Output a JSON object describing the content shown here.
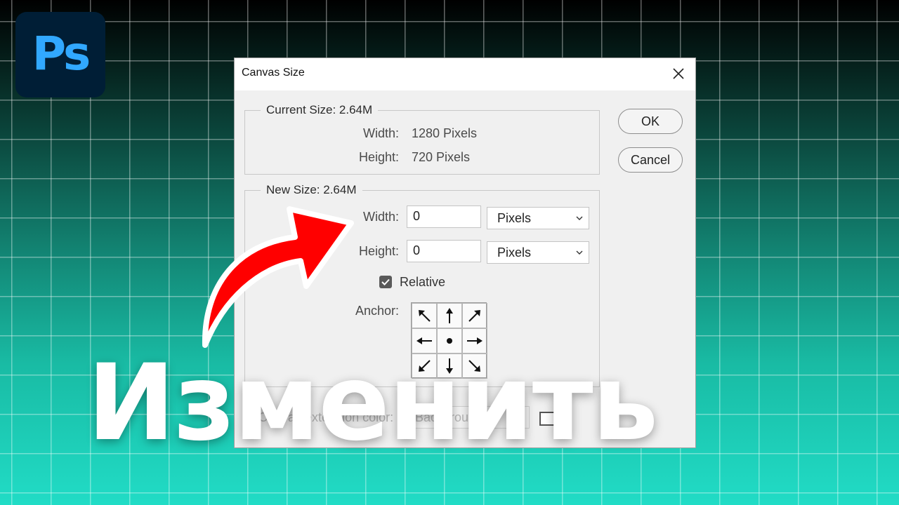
{
  "logo": {
    "text": "Ps",
    "bg_color": "#001e36",
    "fg_color": "#31a8ff"
  },
  "dialog": {
    "title": "Canvas Size",
    "close_icon": "close-icon",
    "current_size": {
      "legend": "Current Size: 2.64M",
      "width_label": "Width:",
      "width_value": "1280 Pixels",
      "height_label": "Height:",
      "height_value": "720 Pixels"
    },
    "new_size": {
      "legend": "New Size: 2.64M",
      "width_label": "Width:",
      "width_value": "0",
      "width_unit": "Pixels",
      "height_label": "Height:",
      "height_value": "0",
      "height_unit": "Pixels",
      "relative_label": "Relative",
      "relative_checked": true,
      "anchor_label": "Anchor:",
      "anchor_selected": "center"
    },
    "buttons": {
      "ok": "OK",
      "cancel": "Cancel"
    },
    "canvas_extension": {
      "label": "Canvas extension color:",
      "select_value": "Background"
    }
  },
  "overlay": {
    "headline": "Изменить",
    "arrow_color": "#ff0000"
  }
}
